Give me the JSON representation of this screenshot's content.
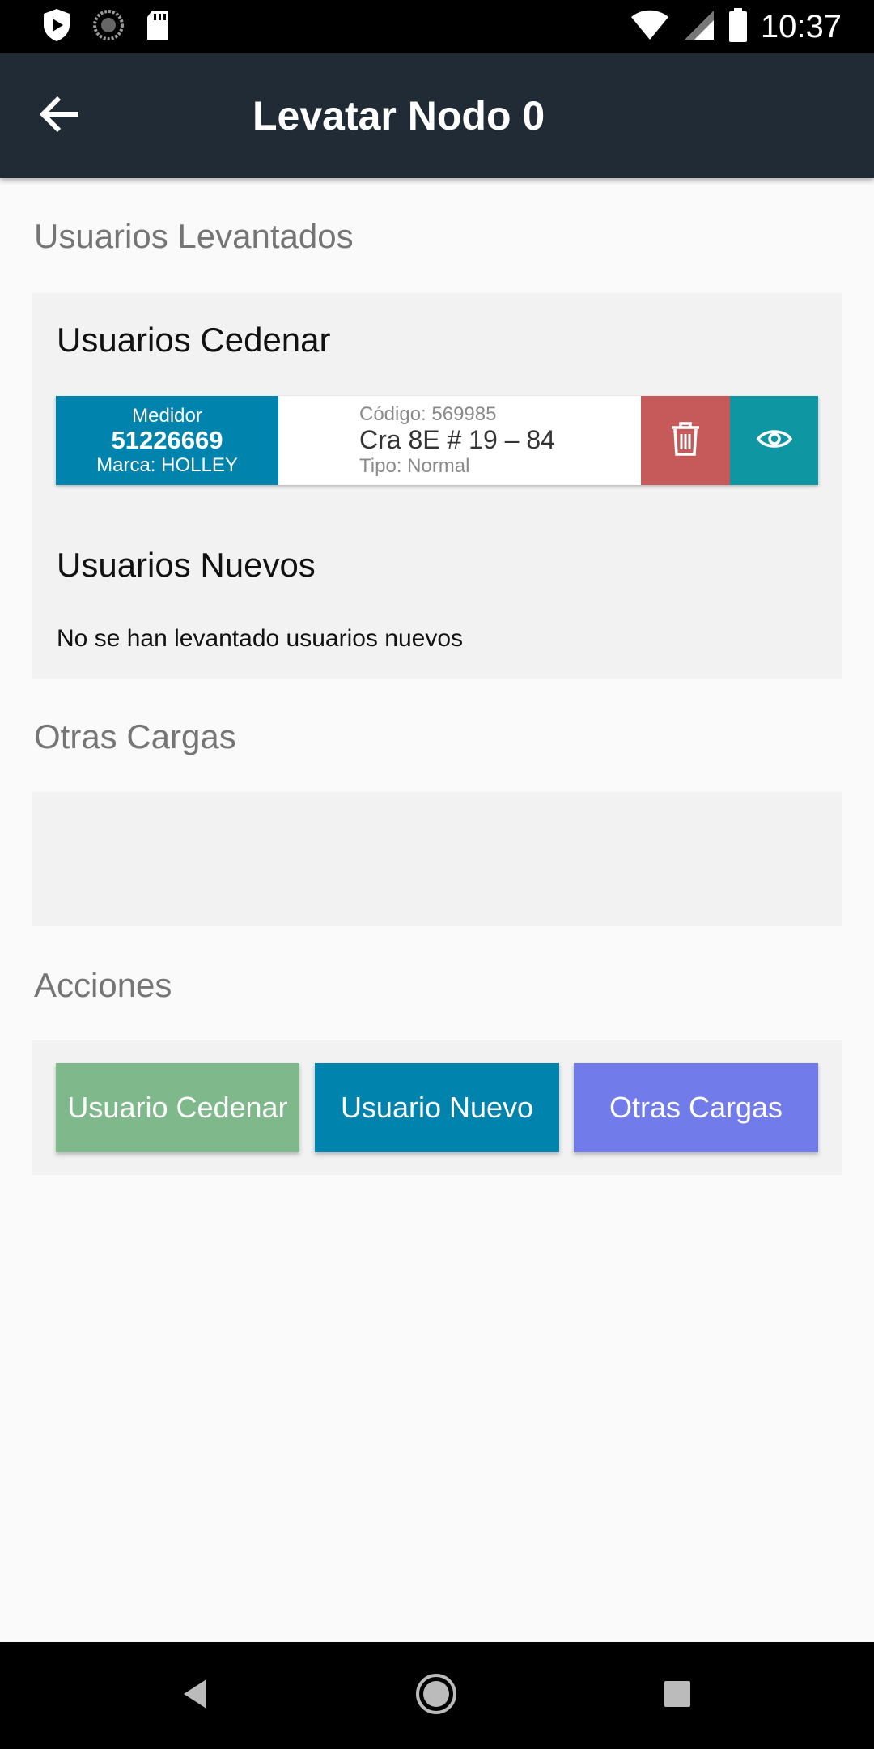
{
  "status_bar": {
    "time": "10:37",
    "icons": [
      "play-protect-icon",
      "sync-icon",
      "sd-card-icon",
      "wifi-icon",
      "cell-signal-icon",
      "battery-icon"
    ]
  },
  "app_bar": {
    "title": "Levatar Nodo 0",
    "back_icon": "arrow-back-icon",
    "background": "#212b36"
  },
  "sections": {
    "usuarios_levantados": "Usuarios Levantados",
    "otras_cargas": "Otras Cargas",
    "acciones": "Acciones"
  },
  "cedenar": {
    "heading": "Usuarios Cedenar",
    "users": [
      {
        "meter_label": "Medidor",
        "meter_number": "51226669",
        "brand": "Marca: HOLLEY",
        "code": "Código: 569985",
        "address": "Cra 8E # 19 – 84",
        "type": "Tipo: Normal"
      }
    ]
  },
  "nuevos": {
    "heading": "Usuarios Nuevos",
    "empty_message": "No se han levantado usuarios nuevos"
  },
  "actions": {
    "usuario_cedenar": "Usuario Cedenar",
    "usuario_nuevo": "Usuario Nuevo",
    "otras_cargas": "Otras Cargas"
  },
  "colors": {
    "meter_bg": "#0083ad",
    "delete_bg": "#c65a5a",
    "view_bg": "#0e97a3",
    "btn_cedenar": "#7fb98b",
    "btn_nuevo": "#0083ad",
    "btn_otras": "#717be9"
  }
}
